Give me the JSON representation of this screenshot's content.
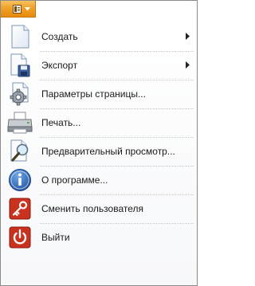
{
  "colors": {
    "app_button": "#f0a22a",
    "separator": "#c6c6c6",
    "frame_border": "#8a8a8a"
  },
  "app_button": {
    "icon": "document-caret-icon"
  },
  "menu": {
    "items": [
      {
        "label": "Создать",
        "icon": "new-document-icon",
        "has_submenu": true
      },
      {
        "label": "Экспорт",
        "icon": "export-save-icon",
        "has_submenu": true
      },
      {
        "label": "Параметры страницы...",
        "icon": "page-settings-icon",
        "has_submenu": false
      },
      {
        "label": "Печать...",
        "icon": "printer-icon",
        "has_submenu": false
      },
      {
        "label": "Предварительный просмотр...",
        "icon": "print-preview-icon",
        "has_submenu": false
      },
      {
        "label": "О программе...",
        "icon": "info-icon",
        "has_submenu": false
      },
      {
        "label": "Сменить пользователя",
        "icon": "key-icon",
        "has_submenu": false
      },
      {
        "label": "Выйти",
        "icon": "power-icon",
        "has_submenu": false
      }
    ]
  }
}
